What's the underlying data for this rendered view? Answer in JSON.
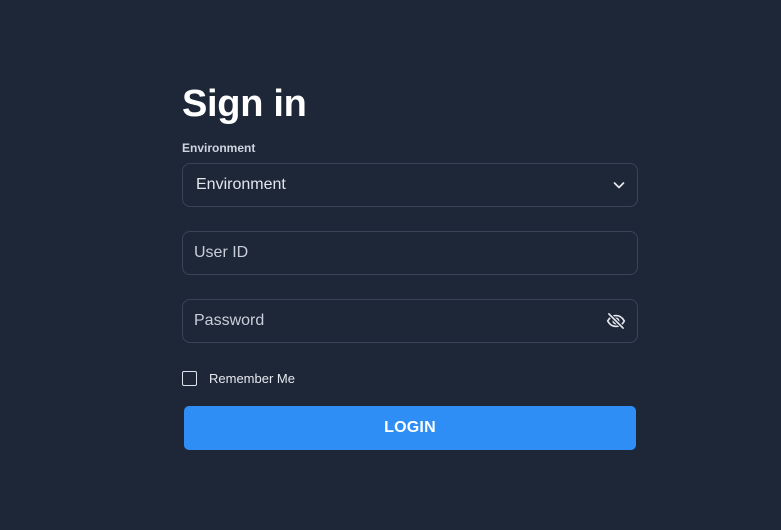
{
  "page": {
    "title": "Sign in"
  },
  "environment": {
    "label": "Environment",
    "selected": "Environment",
    "icon": "chevron-down-icon"
  },
  "user_id": {
    "placeholder": "User ID",
    "value": ""
  },
  "password": {
    "placeholder": "Password",
    "value": "",
    "icon": "eye-off-icon"
  },
  "remember_me": {
    "label": "Remember Me",
    "checked": false
  },
  "login": {
    "label": "LOGIN"
  },
  "colors": {
    "background": "#1e2738",
    "field_border": "#3a4456",
    "accent": "#2e8ef6",
    "text": "#e6e9ef"
  }
}
